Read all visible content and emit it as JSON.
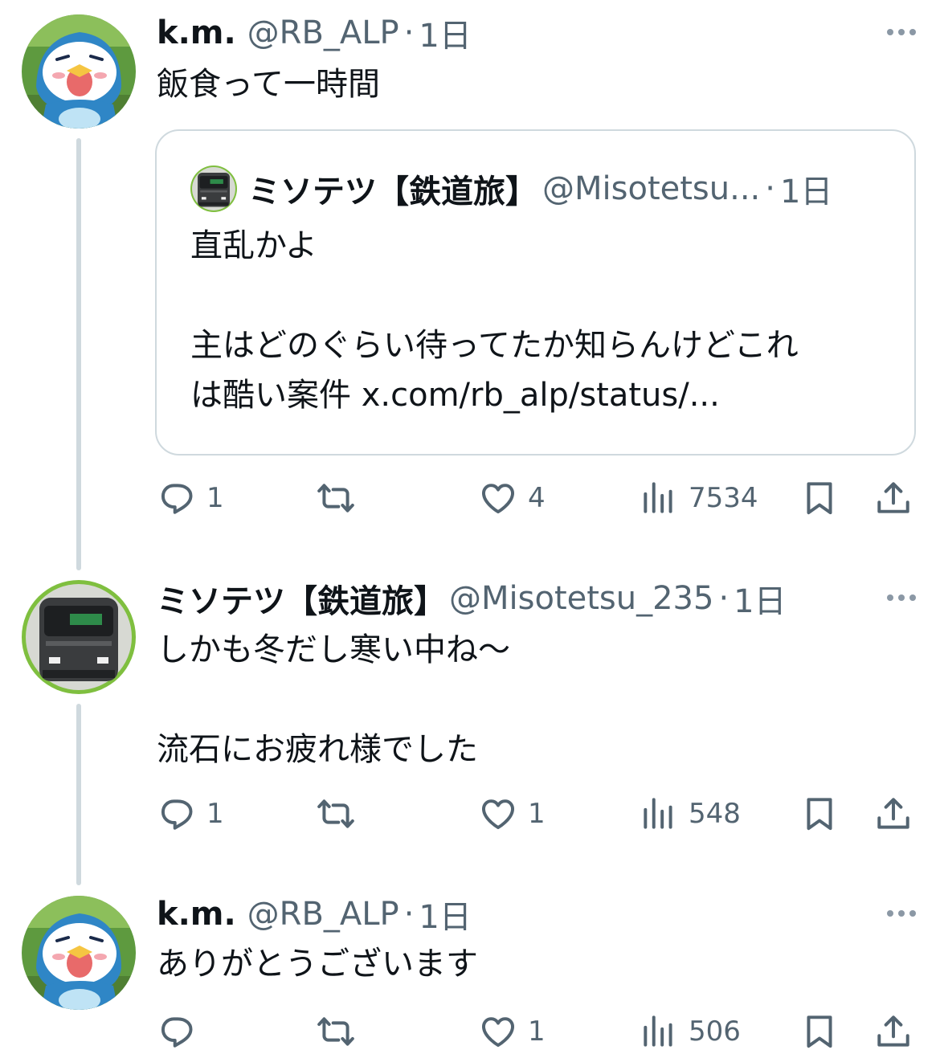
{
  "tweets": [
    {
      "name": "k.m.",
      "handle": "@RB_ALP",
      "dot": "·",
      "time": "1日",
      "text": "飯食って一時間",
      "quote": {
        "name": "ミソテツ【鉄道旅】",
        "handle": "@Misotetsu...",
        "dot": "·",
        "time": "1日",
        "text": "直乱かよ\n\n主はどのぐらい待ってたか知らんけどこれ\nは酷い案件 x.com/rb_alp/status/..."
      },
      "actions": {
        "replies": "1",
        "retweets": "",
        "likes": "4",
        "views": "7534"
      }
    },
    {
      "name": "ミソテツ【鉄道旅】",
      "handle": "@Misotetsu_235",
      "dot": "·",
      "time": "1日",
      "text": "しかも冬だし寒い中ね～\n\n流石にお疲れ様でした",
      "actions": {
        "replies": "1",
        "retweets": "",
        "likes": "1",
        "views": "548"
      }
    },
    {
      "name": "k.m.",
      "handle": "@RB_ALP",
      "dot": "·",
      "time": "1日",
      "text": "ありがとうございます",
      "actions": {
        "replies": "",
        "retweets": "",
        "likes": "1",
        "views": "506"
      }
    }
  ],
  "icons": {
    "reply": "reply-icon",
    "retweet": "retweet-icon",
    "like": "heart-icon",
    "views": "views-icon",
    "bookmark": "bookmark-icon",
    "share": "share-icon",
    "more": "more-icon"
  },
  "colors": {
    "text": "#0f1419",
    "secondary": "#536471",
    "border": "#cfd9de"
  }
}
